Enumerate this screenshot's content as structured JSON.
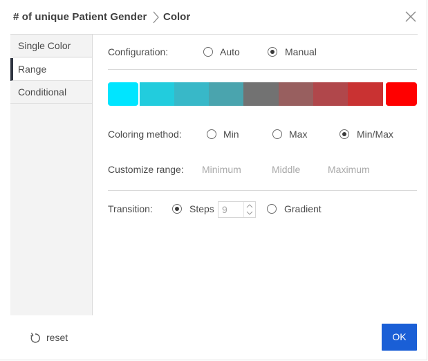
{
  "header": {
    "title": "# of unique Patient Gender",
    "subtitle": "Color"
  },
  "sidebar": {
    "items": [
      {
        "label": "Single Color",
        "active": false
      },
      {
        "label": "Range",
        "active": true
      },
      {
        "label": "Conditional",
        "active": false
      }
    ]
  },
  "configuration": {
    "label": "Configuration:",
    "options": [
      {
        "label": "Auto",
        "selected": false
      },
      {
        "label": "Manual",
        "selected": true
      }
    ]
  },
  "colorbar": {
    "swatches": [
      "#00e5ff",
      "#22ccdd",
      "#38b8c8",
      "#4aa4ae",
      "#727272",
      "#985f5f",
      "#b0474b",
      "#c93232",
      "#ff0000"
    ]
  },
  "coloring_method": {
    "label": "Coloring method:",
    "options": [
      {
        "label": "Min",
        "selected": false
      },
      {
        "label": "Max",
        "selected": false
      },
      {
        "label": "Min/Max",
        "selected": true
      }
    ]
  },
  "customize_range": {
    "label": "Customize range:",
    "placeholders": {
      "minimum": "Minimum",
      "middle": "Middle",
      "maximum": "Maximum"
    }
  },
  "transition": {
    "label": "Transition:",
    "steps_label": "Steps",
    "steps_value": "9",
    "steps_selected": true,
    "gradient_label": "Gradient",
    "gradient_selected": false
  },
  "footer": {
    "reset_label": "reset",
    "ok_label": "OK"
  },
  "colors": {
    "accent": "#1a5fd6",
    "sidebar_bg": "#f3f3f3",
    "active_indicator": "#2e3440"
  }
}
